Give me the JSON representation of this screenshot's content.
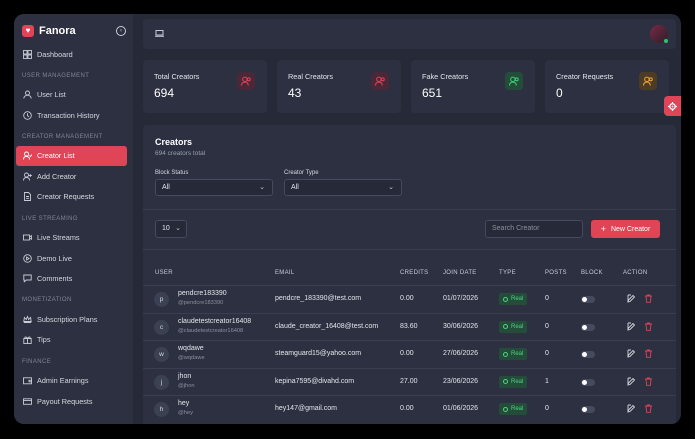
{
  "brand": {
    "name": "Fanora"
  },
  "sidebar": {
    "sections": [
      {
        "title": "",
        "items": [
          {
            "label": "Dashboard",
            "icon": "dashboard-icon"
          }
        ]
      },
      {
        "title": "USER MANAGEMENT",
        "items": [
          {
            "label": "User List",
            "icon": "user-icon"
          },
          {
            "label": "Transaction History",
            "icon": "history-icon"
          }
        ]
      },
      {
        "title": "CREATOR MANAGEMENT",
        "items": [
          {
            "label": "Creator List",
            "icon": "user-list-icon",
            "active": true
          },
          {
            "label": "Add Creator",
            "icon": "add-user-icon"
          },
          {
            "label": "Creator Requests",
            "icon": "document-icon"
          }
        ]
      },
      {
        "title": "LIVE STREAMING",
        "items": [
          {
            "label": "Live Streams",
            "icon": "video-icon"
          },
          {
            "label": "Demo Live",
            "icon": "play-icon"
          },
          {
            "label": "Comments",
            "icon": "comment-icon"
          }
        ]
      },
      {
        "title": "MONETIZATION",
        "items": [
          {
            "label": "Subscription Plans",
            "icon": "crown-icon"
          },
          {
            "label": "Tips",
            "icon": "gift-icon"
          }
        ]
      },
      {
        "title": "FINANCE",
        "items": [
          {
            "label": "Admin Earnings",
            "icon": "wallet-icon"
          },
          {
            "label": "Payout Requests",
            "icon": "payout-icon"
          }
        ]
      }
    ]
  },
  "stats": [
    {
      "label": "Total Creators",
      "value": "694",
      "color": "#e04457"
    },
    {
      "label": "Real Creators",
      "value": "43",
      "color": "#e04457"
    },
    {
      "label": "Fake Creators",
      "value": "651",
      "color": "#3ccf7a"
    },
    {
      "label": "Creator Requests",
      "value": "0",
      "color": "#f2a33a"
    }
  ],
  "panel": {
    "title": "Creators",
    "subtitle": "694 creators total",
    "filters": {
      "block_label": "Block Status",
      "block_value": "All",
      "type_label": "Creator Type",
      "type_value": "All"
    },
    "page_size": "10",
    "search_placeholder": "Search Creator",
    "new_button": "New Creator"
  },
  "table": {
    "headers": [
      "USER",
      "EMAIL",
      "CREDITS",
      "JOIN DATE",
      "TYPE",
      "POSTS",
      "BLOCK",
      "ACTION"
    ],
    "rows": [
      {
        "initial": "p",
        "name": "pendcre183390",
        "handle": "@pendcre183390",
        "email": "pendcre_183390@test.com",
        "credits": "0.00",
        "date": "01/07/2026",
        "type": "Real",
        "posts": "0"
      },
      {
        "initial": "c",
        "name": "claudetestcreator16408",
        "handle": "@claudetestcreator16408",
        "email": "claude_creator_16408@test.com",
        "credits": "83.60",
        "date": "30/06/2026",
        "type": "Real",
        "posts": "0"
      },
      {
        "initial": "w",
        "name": "wqdawe",
        "handle": "@wqdawe",
        "email": "steamguard15@yahoo.com",
        "credits": "0.00",
        "date": "27/06/2026",
        "type": "Real",
        "posts": "0"
      },
      {
        "initial": "j",
        "name": "jhon",
        "handle": "@jhon",
        "email": "kepina7595@divahd.com",
        "credits": "27.00",
        "date": "23/06/2026",
        "type": "Real",
        "posts": "1"
      },
      {
        "initial": "h",
        "name": "hey",
        "handle": "@hey",
        "email": "hey147@gmail.com",
        "credits": "0.00",
        "date": "01/06/2026",
        "type": "Real",
        "posts": "0"
      }
    ]
  }
}
